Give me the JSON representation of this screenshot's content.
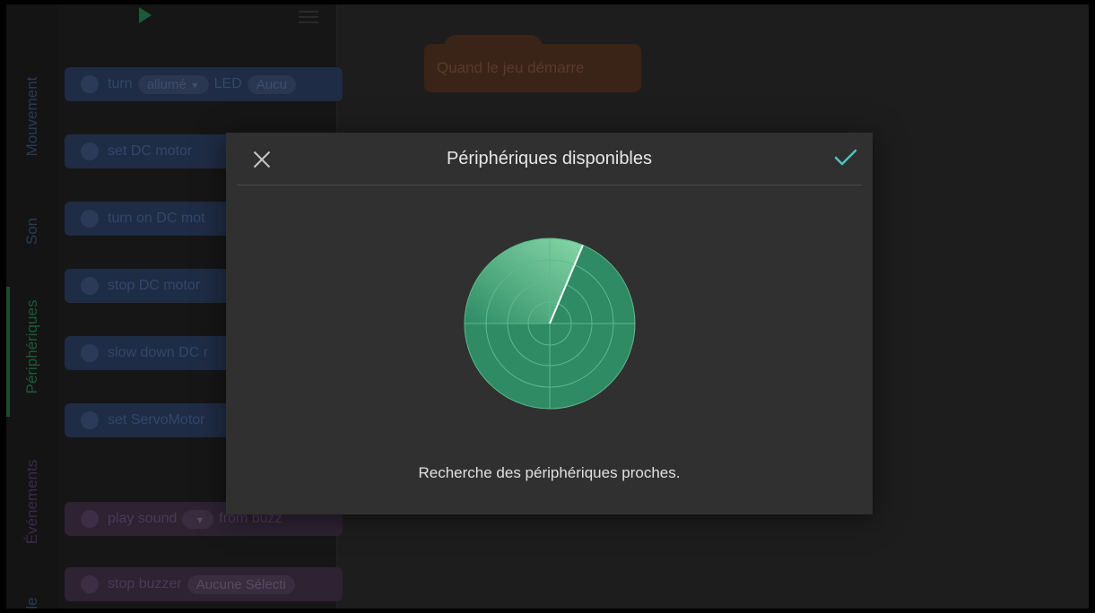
{
  "categories": [
    "Mouvement",
    "Son",
    "Périphériques",
    "Événements",
    "le"
  ],
  "palette_blocks": [
    {
      "prefix": "turn",
      "pill": "allumé",
      "mid": "LED",
      "pill2": "Aucu",
      "type": "motion"
    },
    {
      "prefix": "set DC motor",
      "type": "motion"
    },
    {
      "prefix": "turn on DC mot",
      "type": "motion"
    },
    {
      "prefix": "stop DC motor",
      "type": "motion"
    },
    {
      "prefix": "slow down DC r",
      "type": "motion"
    },
    {
      "prefix": "set ServoMotor",
      "type": "motion"
    },
    {
      "prefix": "play sound",
      "mid": "from buzz",
      "type": "sound"
    },
    {
      "prefix": "stop buzzer",
      "pill": "Aucune Sélecti",
      "type": "sound"
    }
  ],
  "workspace": {
    "start_block": "Quand le jeu démarre"
  },
  "modal": {
    "title": "Périphériques disponibles",
    "status": "Recherche des périphériques proches.",
    "close_icon": "close-icon",
    "confirm_icon": "checkmark-icon",
    "accent_color": "#4fc3c0",
    "radar_color": "#2e8b64"
  }
}
